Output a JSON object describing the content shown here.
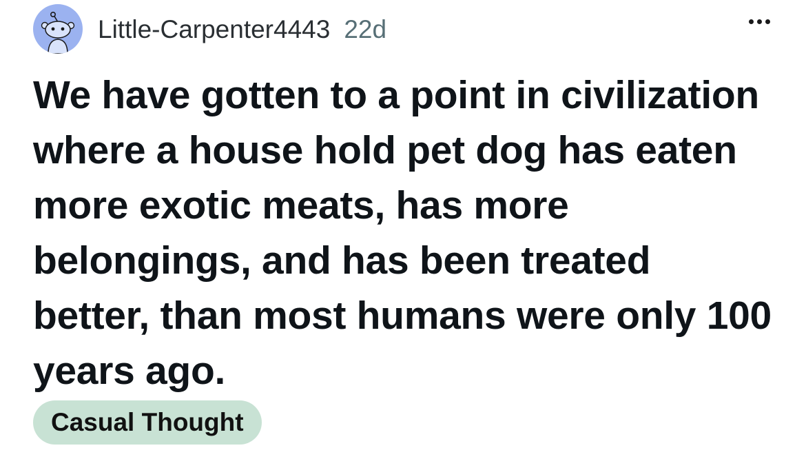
{
  "post": {
    "author": "Little-Carpenter4443",
    "age": "22d",
    "avatar_icon": "reddit-snoo-avatar-icon",
    "more_icon": "more-options-icon",
    "title": "We have gotten to a point in civilization where a house hold pet dog has eaten more exotic meats, has more belongings, and has been treated better, than most humans were only 100 years ago.",
    "flair": "Casual Thought"
  },
  "colors": {
    "avatar_bg": "#9bb2f0",
    "flair_bg": "#c8e2d4",
    "meta_text": "#576f76"
  }
}
